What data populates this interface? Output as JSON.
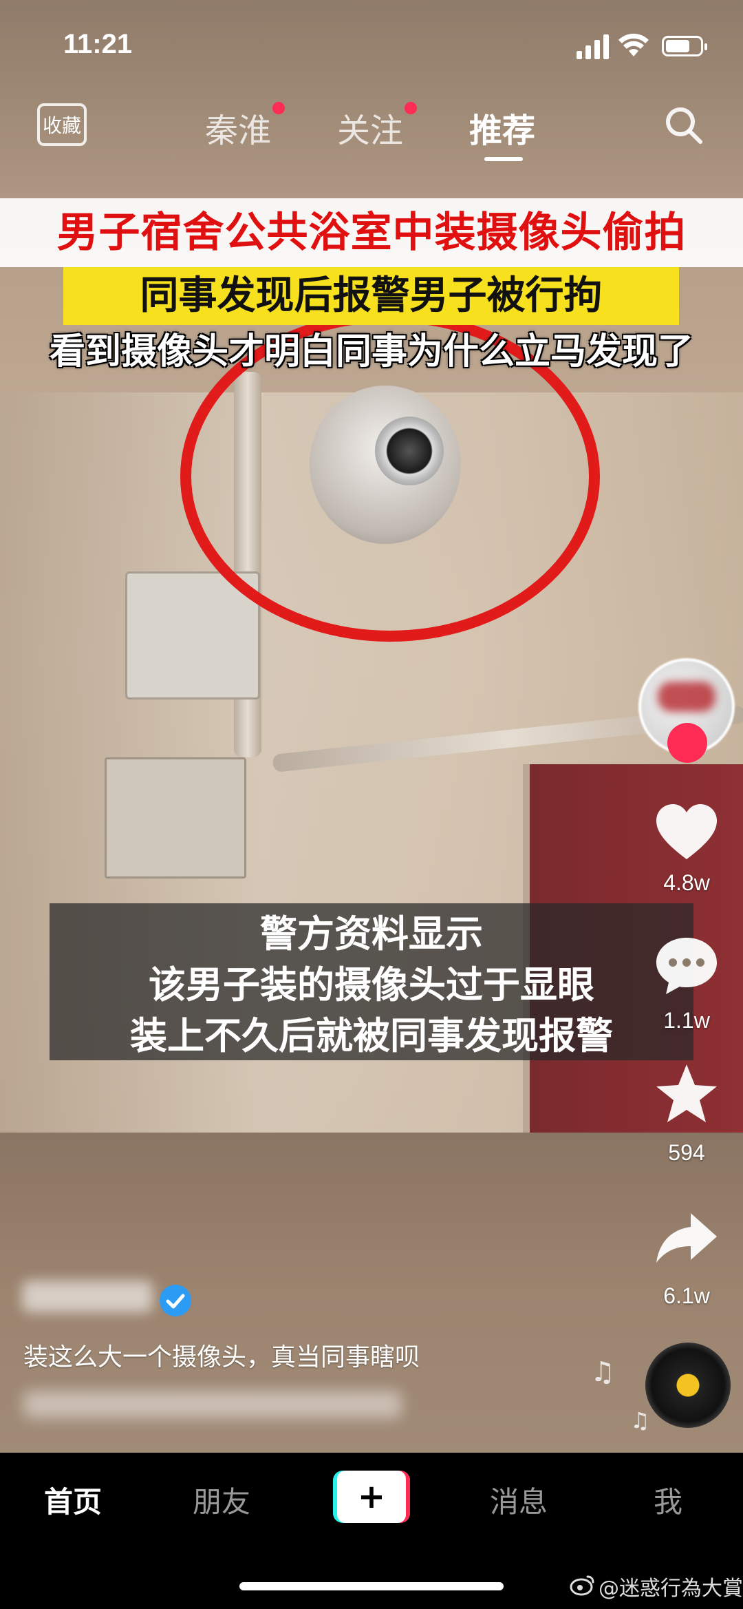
{
  "status_bar": {
    "time": "11:21"
  },
  "top_nav": {
    "favorites_label": "收藏",
    "tabs": [
      {
        "label": "秦淮",
        "has_dot": true
      },
      {
        "label": "关注",
        "has_dot": true
      },
      {
        "label": "推荐",
        "active": true
      }
    ]
  },
  "video": {
    "caption_line1": "男子宿舍公共浴室中装摄像头偷拍",
    "caption_line2": "同事发现后报警男子被行拘",
    "caption_line3": "看到摄像头才明白同事为什么立马发现了",
    "subtitle_lines": [
      "警方资料显示",
      "该男子装的摄像头过于显眼",
      "装上不久后就被同事发现报警"
    ]
  },
  "actions": {
    "like_count": "4.8w",
    "comment_count": "1.1w",
    "favorite_count": "594",
    "share_count": "6.1w"
  },
  "post": {
    "description": "装这么大一个摄像头，真当同事瞎呗"
  },
  "bottom_nav": {
    "items": [
      "首页",
      "朋友",
      "+",
      "消息",
      "我"
    ]
  },
  "watermark": "@迷惑行為大賞",
  "colors": {
    "accent_red": "#fe2c55",
    "caption_red": "#e01010",
    "caption_yellow": "#f7e11e",
    "verified_blue": "#2b9bf4"
  }
}
